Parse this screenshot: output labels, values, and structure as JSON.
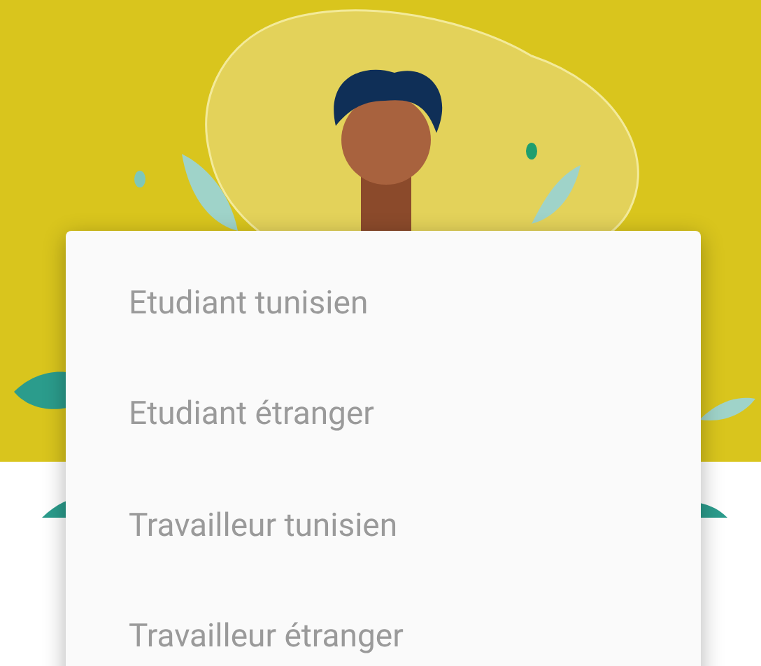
{
  "menu": {
    "items": [
      {
        "label": "Etudiant tunisien"
      },
      {
        "label": "Etudiant étranger"
      },
      {
        "label": "Travailleur tunisien"
      },
      {
        "label": "Travailleur étranger"
      }
    ]
  }
}
